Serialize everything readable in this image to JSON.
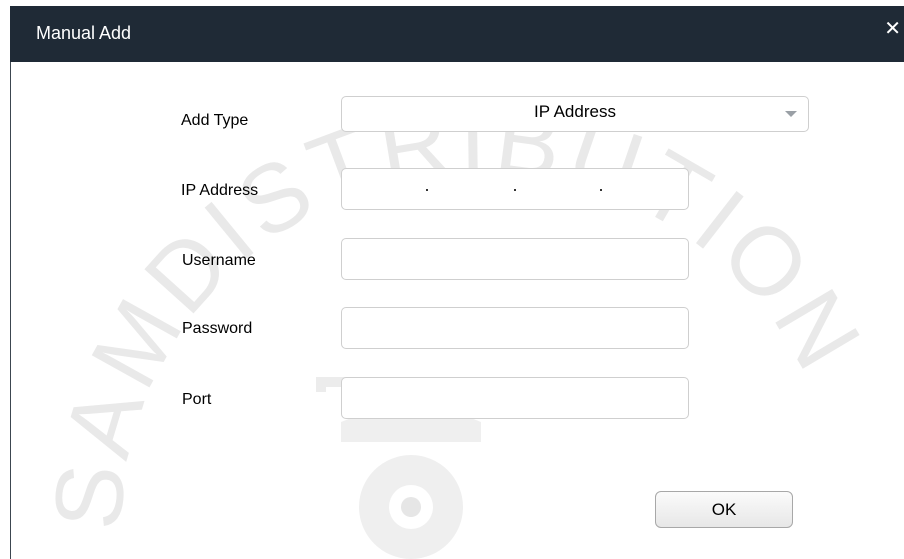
{
  "window": {
    "title": "Manual Add",
    "close_glyph": "✕"
  },
  "form": {
    "add_type_label": "Add Type",
    "add_type_value": "IP Address",
    "ip_label": "IP Address",
    "ip_value": "",
    "username_label": "Username",
    "username_value": "",
    "password_label": "Password",
    "password_value": "",
    "port_label": "Port",
    "port_value": ""
  },
  "actions": {
    "ok_label": "OK"
  },
  "watermark": {
    "text": "SAMDISTRIBUTION"
  },
  "colors": {
    "titlebar": "#1f2a36",
    "field_border": "#cfcfcf"
  }
}
